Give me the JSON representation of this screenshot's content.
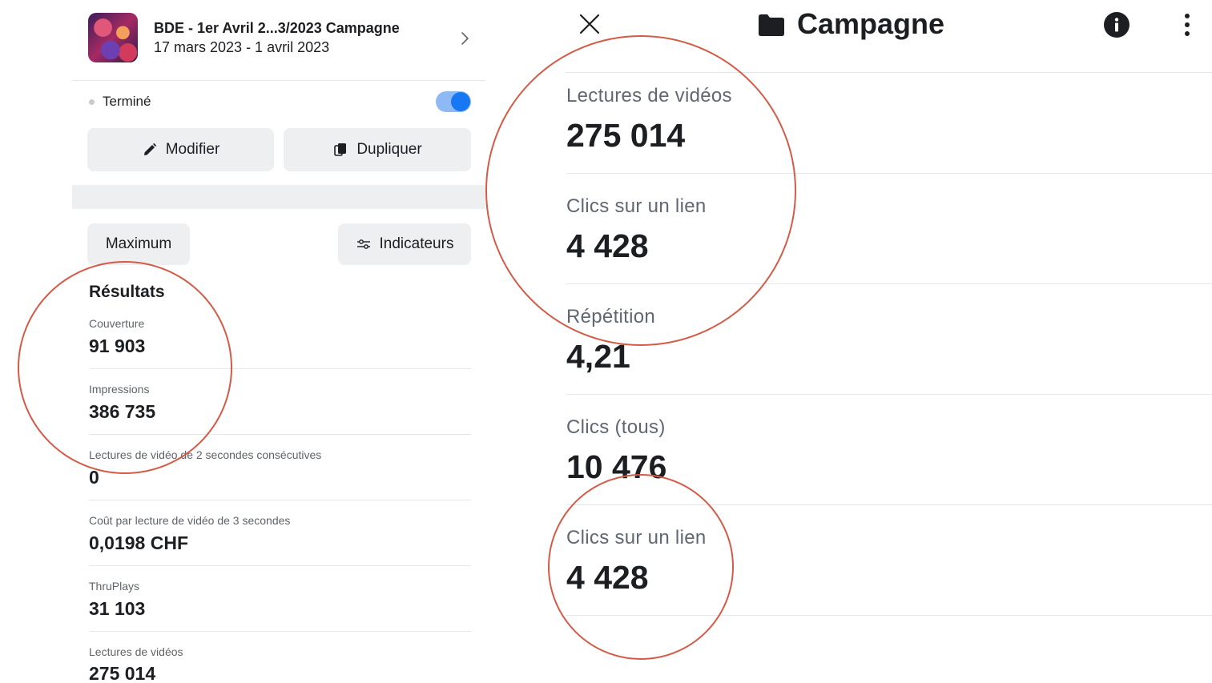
{
  "left_panel": {
    "campaign": {
      "title": "BDE -  1er Avril 2...3/2023 Campagne",
      "dates": "17 mars 2023 - 1 avril 2023"
    },
    "status": {
      "label": "Terminé",
      "toggle_on": true
    },
    "buttons": {
      "edit": "Modifier",
      "duplicate": "Dupliquer",
      "maximum": "Maximum",
      "indicators": "Indicateurs"
    },
    "results": {
      "title": "Résultats",
      "metrics": [
        {
          "label": "Couverture",
          "value": "91 903"
        },
        {
          "label": "Impressions",
          "value": "386 735"
        },
        {
          "label": "Lectures de vidéo de 2 secondes consécutives",
          "value": "0"
        },
        {
          "label": "Coût par lecture de vidéo de 3 secondes",
          "value": "0,0198 CHF"
        },
        {
          "label": "ThruPlays",
          "value": "31 103"
        },
        {
          "label": "Lectures de vidéos",
          "value": "275 014"
        }
      ]
    }
  },
  "right_panel": {
    "title": "Campagne",
    "metrics": [
      {
        "label": "Lectures de vidéos",
        "value": "275 014"
      },
      {
        "label": "Clics sur un lien",
        "value": "4 428"
      },
      {
        "label": "Répétition",
        "value": "4,21"
      },
      {
        "label": "Clics (tous)",
        "value": "10 476"
      },
      {
        "label": "Clics sur un lien",
        "value": "4 428"
      }
    ]
  },
  "colors": {
    "accent": "#1877f2",
    "annotation": "#d35b47",
    "divider": "#e6e7ea",
    "button_bg": "#eeeff1"
  }
}
